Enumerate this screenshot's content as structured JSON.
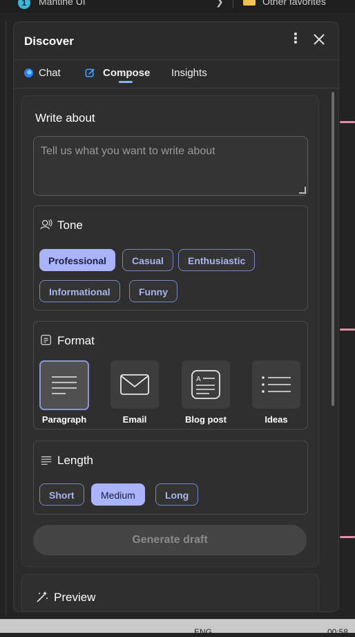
{
  "browser": {
    "bookmark_left": "Mantine UI",
    "bookmark_badge": "1",
    "bookmark_right": "Other favorites"
  },
  "panel": {
    "title": "Discover",
    "more_icon": "more-vertical-icon",
    "close_icon": "close-icon"
  },
  "tabs": [
    {
      "label": "Chat",
      "icon": "chat-icon",
      "active": false
    },
    {
      "label": "Compose",
      "icon": "compose-icon",
      "active": true
    },
    {
      "label": "Insights",
      "active": false
    }
  ],
  "compose": {
    "write_label": "Write about",
    "write_placeholder": "Tell us what you want to write about",
    "tone": {
      "title": "Tone",
      "icon": "tone-icon",
      "options": [
        "Professional",
        "Casual",
        "Enthusiastic",
        "Informational",
        "Funny"
      ],
      "selected": "Professional"
    },
    "format": {
      "title": "Format",
      "icon": "format-icon",
      "options": [
        {
          "label": "Paragraph",
          "icon": "paragraph-icon"
        },
        {
          "label": "Email",
          "icon": "email-icon"
        },
        {
          "label": "Blog post",
          "icon": "blog-post-icon"
        },
        {
          "label": "Ideas",
          "icon": "ideas-icon"
        }
      ],
      "selected": "Paragraph"
    },
    "length": {
      "title": "Length",
      "icon": "length-icon",
      "options": [
        "Short",
        "Medium",
        "Long"
      ],
      "selected": "Medium"
    },
    "generate_label": "Generate draft"
  },
  "preview": {
    "title": "Preview",
    "icon": "magic-wand-icon"
  },
  "taskbar": {
    "language": "ENG",
    "time": "00:58"
  },
  "colors": {
    "accent": "#a9b4fb",
    "panel_bg": "#2b2b2b",
    "card_bg": "#2f2f2f"
  }
}
